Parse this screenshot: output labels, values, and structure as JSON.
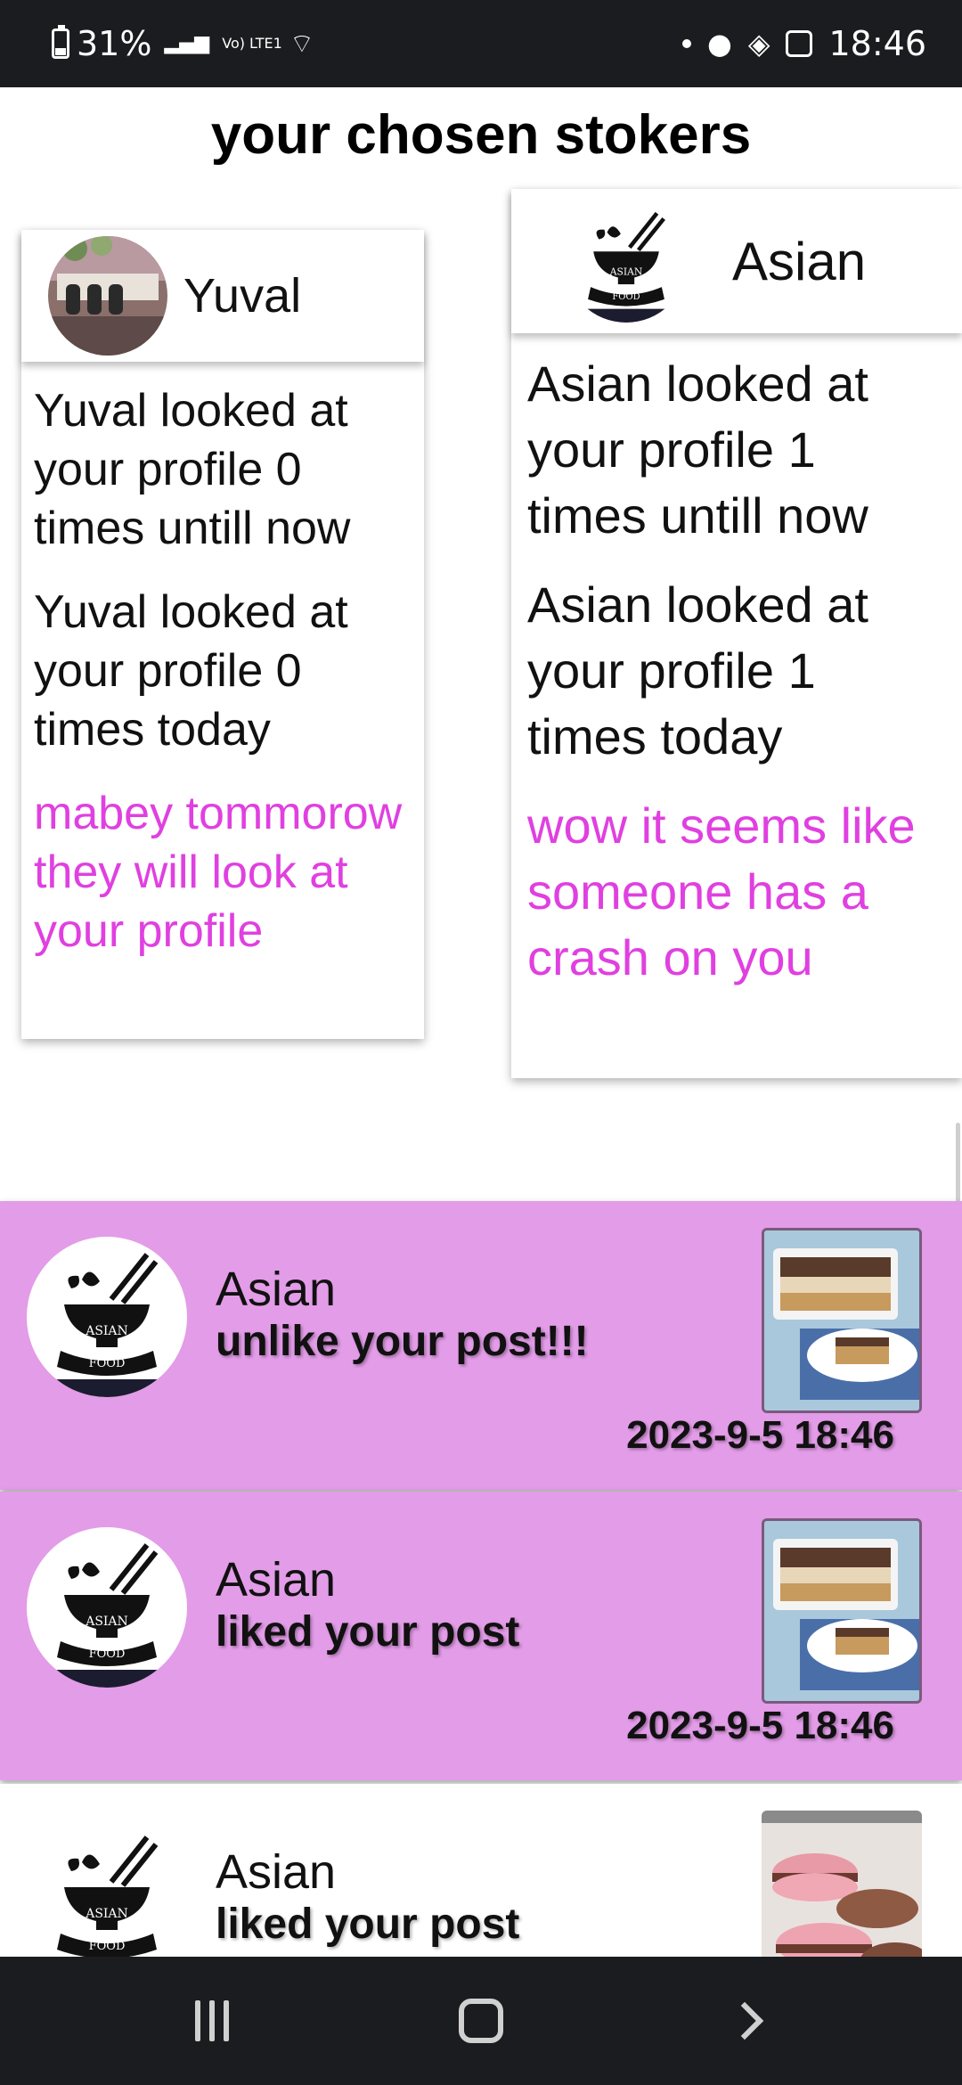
{
  "status_bar": {
    "battery": "31%",
    "network": "Vo) LTE1",
    "time": "18:46"
  },
  "page": {
    "title": "your chosen stokers"
  },
  "stalkers": [
    {
      "name": "Yuval",
      "avatar": "profile-photo",
      "total_line": "Yuval looked at your profile 0 times untill now",
      "today_line": "Yuval looked at your profile 0 times today",
      "message": "mabey tommorow they will look at your profile"
    },
    {
      "name": "Asian",
      "avatar": "asian-food-logo",
      "total_line": "Asian looked at your profile 1 times untill now",
      "today_line": "Asian looked at your profile 1 times today",
      "message": "wow it seems like someone has a crash on you"
    }
  ],
  "notifications": [
    {
      "sender": "Asian",
      "action": "unlike your post!!!",
      "time": "2023-9-5 18:46",
      "thumbnail": "tiramisu-dessert"
    },
    {
      "sender": "Asian",
      "action": "liked your post",
      "time": "2023-9-5 18:46",
      "thumbnail": "tiramisu-dessert"
    },
    {
      "sender": "Asian",
      "action": "liked your post",
      "thumbnail": "pink-macarons"
    }
  ],
  "logo": {
    "text_top": "ASIAN",
    "text_bottom": "FOOD"
  },
  "colors": {
    "accent_pink": "#e040e0",
    "notification_bg": "#e39ce8",
    "system_bar": "#1b1c1f"
  }
}
